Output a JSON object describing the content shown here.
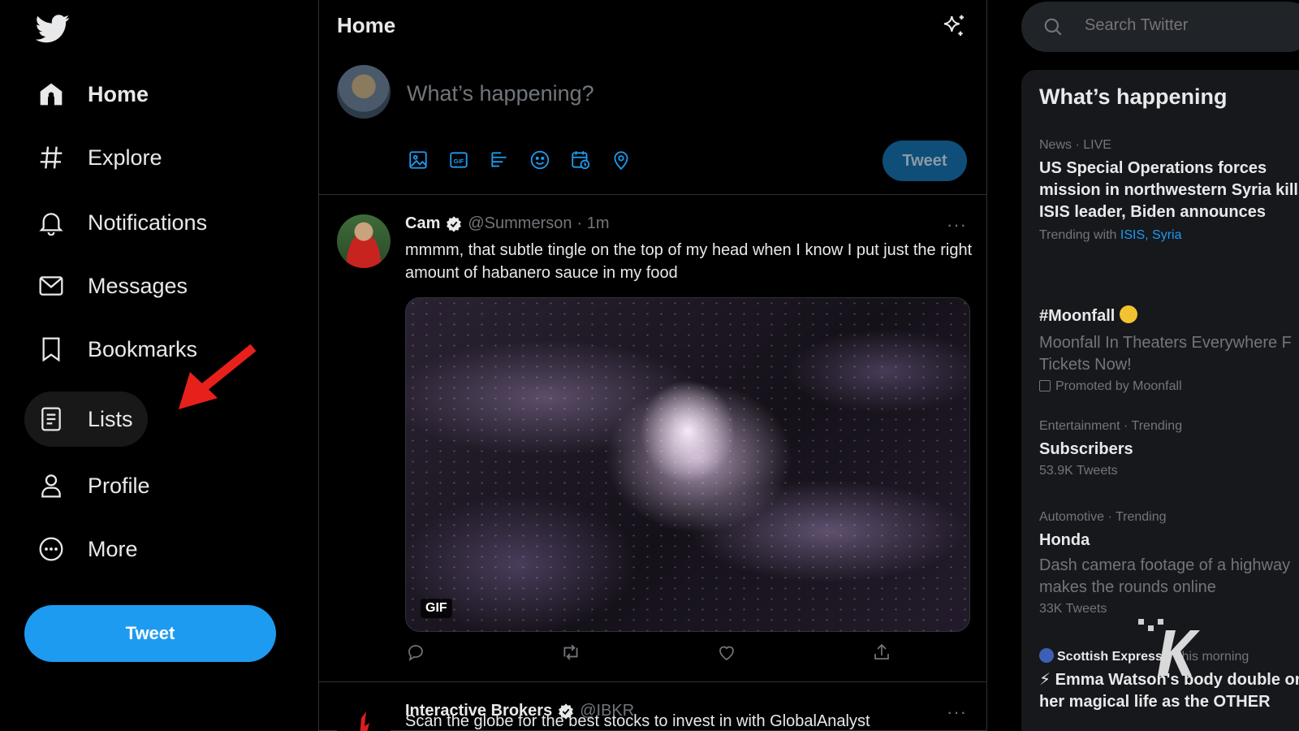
{
  "sidebar": {
    "nav": [
      {
        "label": "Home",
        "icon": "home-icon",
        "active_bold": true
      },
      {
        "label": "Explore",
        "icon": "hashtag-icon"
      },
      {
        "label": "Notifications",
        "icon": "bell-icon"
      },
      {
        "label": "Messages",
        "icon": "envelope-icon"
      },
      {
        "label": "Bookmarks",
        "icon": "bookmark-icon"
      },
      {
        "label": "Lists",
        "icon": "list-icon",
        "highlighted": true
      },
      {
        "label": "Profile",
        "icon": "person-icon"
      },
      {
        "label": "More",
        "icon": "more-circle-icon"
      }
    ],
    "tweet_button": "Tweet"
  },
  "main": {
    "title": "Home",
    "compose": {
      "placeholder": "What’s happening?",
      "tweet_button": "Tweet",
      "tools": [
        "image-icon",
        "gif-icon",
        "poll-icon",
        "emoji-icon",
        "schedule-icon",
        "location-icon"
      ]
    },
    "tweets": [
      {
        "name": "Cam",
        "handle": "@Summerson",
        "time": "· 1m",
        "text": "mmmm, that subtle tingle on the top of my head when I know I put just the right amount of habanero sauce in my food",
        "media_badge": "GIF",
        "more": "···"
      },
      {
        "name": "Interactive Brokers",
        "handle": "@IBKR",
        "time": "",
        "text": "Scan the globe for the best stocks to invest in with GlobalAnalyst",
        "more": "···"
      }
    ]
  },
  "right": {
    "search_placeholder": "Search Twitter",
    "trends_title": "What’s happening",
    "trends": [
      {
        "meta": "News · LIVE",
        "title": "US Special Operations forces mission in northwestern Syria kills ISIS leader, Biden announces",
        "foot_prefix": "Trending with",
        "foot_link1": "ISIS",
        "foot_sep": ",",
        "foot_link2": "Syria"
      },
      {
        "meta": "",
        "title": "#Moonfall",
        "desc": "Moonfall In Theaters Everywhere F Tickets Now!",
        "foot": "Promoted by Moonfall"
      },
      {
        "meta": "Entertainment · Trending",
        "title": "Subscribers",
        "foot": "53.9K Tweets"
      },
      {
        "meta": "Automotive · Trending",
        "title": "Honda",
        "desc": "Dash camera footage of a highway makes the rounds online",
        "foot": "33K Tweets"
      },
      {
        "meta_source": "Scottish Express",
        "meta_time": "· This morning",
        "title": "⚡ Emma Watson's body double on her magical life as the OTHER"
      }
    ]
  },
  "colors": {
    "accent": "#1d9bf0",
    "background": "#000000",
    "muted": "#71767b",
    "text": "#e7e9ea",
    "annotation_arrow": "#e8201c"
  }
}
